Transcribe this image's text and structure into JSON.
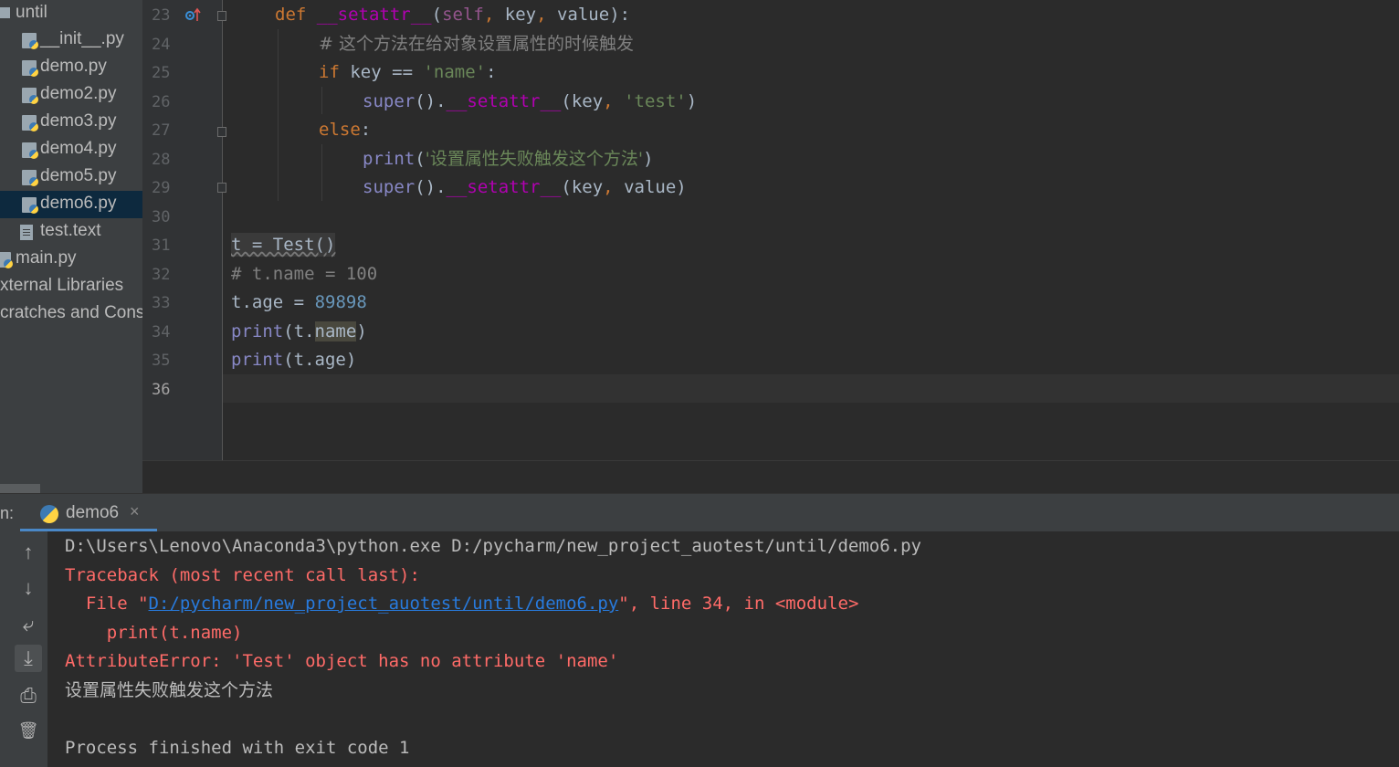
{
  "sidebar": {
    "folder": "until",
    "items": [
      {
        "label": "__init__.py",
        "type": "py"
      },
      {
        "label": "demo.py",
        "type": "py"
      },
      {
        "label": "demo2.py",
        "type": "py"
      },
      {
        "label": "demo3.py",
        "type": "py"
      },
      {
        "label": "demo4.py",
        "type": "py"
      },
      {
        "label": "demo5.py",
        "type": "py"
      },
      {
        "label": "demo6.py",
        "type": "py",
        "selected": true
      },
      {
        "label": "test.text",
        "type": "text"
      }
    ],
    "main": "main.py",
    "external": "xternal Libraries",
    "scratches": "cratches and Cons"
  },
  "editor": {
    "line_numbers": [
      "23",
      "24",
      "25",
      "26",
      "27",
      "28",
      "29",
      "30",
      "31",
      "32",
      "33",
      "34",
      "35",
      "36"
    ],
    "current_line": "36",
    "tokens": {
      "def": "def",
      "setattr": "__setattr__",
      "self": "self",
      "comma": ",",
      "key": "key",
      "value": "value",
      "close_colon": "):",
      "lparen": "(",
      "comment24": "# 这个方法在给对象设置属性的时候触发",
      "if": "if",
      "eq": "==",
      "str_name": "'name'",
      "colon": ":",
      "super": "super",
      "call_dot": "().",
      "str_test": "'test'",
      "rparen": ")",
      "else": "else",
      "print": "print",
      "str_cn": "'设置属性失败触发这个方法'",
      "line31": "t = Test()",
      "comment32": "# t.name = 100",
      "t_age": "t.age",
      "assign": "=",
      "num": "89898",
      "t_dot": "t.",
      "name": "name",
      "age": "age"
    }
  },
  "run": {
    "label": "n:",
    "tab": "demo6",
    "close": "×"
  },
  "console": {
    "cmd": "D:\\Users\\Lenovo\\Anaconda3\\python.exe D:/pycharm/new_project_auotest/until/demo6.py",
    "traceback": "Traceback (most recent call last):",
    "file_prefix": "  File \"",
    "file_link": "D:/pycharm/new_project_auotest/until/demo6.py",
    "file_suffix": "\", line 34, in <module>",
    "code_line": "    print(t.name)",
    "error": "AttributeError: 'Test' object has no attribute 'name'",
    "output_cn": "设置属性失败触发这个方法",
    "finished": "Process finished with exit code 1"
  },
  "tools": {
    "up": "↑",
    "down": "↓",
    "wrap": "⤶",
    "scroll_end": "⤓",
    "print": "⎙",
    "trash": "🗑"
  }
}
